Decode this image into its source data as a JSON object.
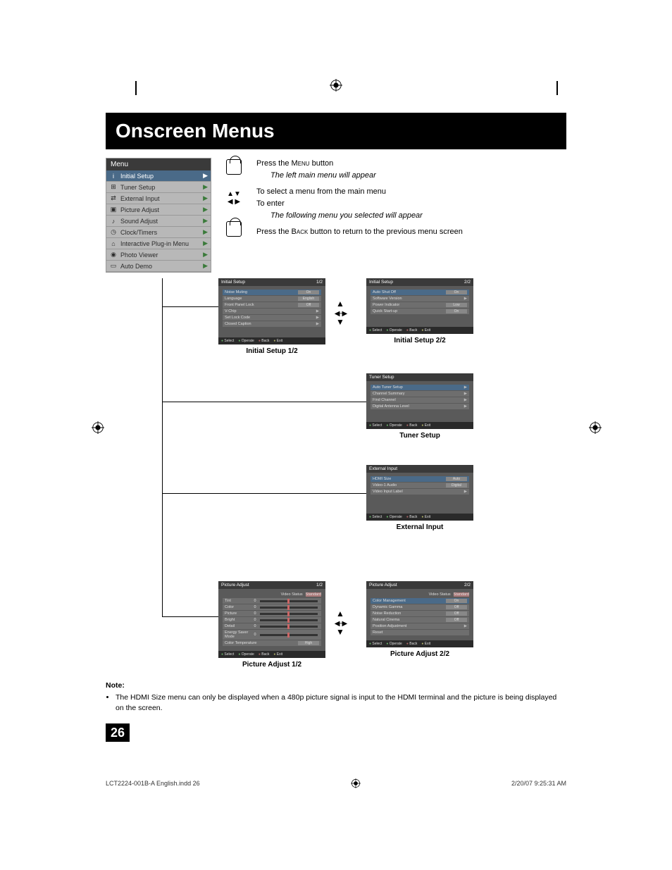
{
  "page": {
    "title": "Onscreen Menus",
    "number": "26",
    "footer_file": "LCT2224-001B-A English.indd   26",
    "footer_time": "2/20/07   9:25:31 AM"
  },
  "main_menu": {
    "header": "Menu",
    "items": [
      {
        "icon": "i",
        "label": "Initial Setup",
        "selected": true
      },
      {
        "icon": "⊞",
        "label": "Tuner Setup"
      },
      {
        "icon": "⇄",
        "label": "External Input"
      },
      {
        "icon": "▣",
        "label": "Picture Adjust"
      },
      {
        "icon": "♪",
        "label": "Sound Adjust"
      },
      {
        "icon": "◷",
        "label": "Clock/Timers"
      },
      {
        "icon": "⌂",
        "label": "Interactive Plug-in Menu"
      },
      {
        "icon": "◉",
        "label": "Photo Viewer"
      },
      {
        "icon": "▭",
        "label": "Auto Demo"
      }
    ]
  },
  "instructions": {
    "l1a": "Press the ",
    "l1b": "Menu",
    "l1c": " button",
    "l2": "The left main menu will appear",
    "l3": "To select a menu from the main menu",
    "l4": "To enter",
    "l5": "The following menu you selected will appear",
    "l6a": "Press the ",
    "l6b": "Back",
    "l6c": " button to return to the previous menu screen"
  },
  "subs": {
    "initial1": {
      "title": "Initial Setup",
      "page": "1/2",
      "caption": "Initial Setup 1/2",
      "rows": [
        {
          "l": "Noise Muting",
          "v": "On",
          "sel": true
        },
        {
          "l": "Language",
          "v": "English"
        },
        {
          "l": "Front Panel Lock",
          "v": "Off"
        },
        {
          "l": "V-Chip",
          "arr": true
        },
        {
          "l": "Set Lock Code",
          "arr": true
        },
        {
          "l": "Closed Caption",
          "arr": true
        }
      ]
    },
    "initial2": {
      "title": "Initial Setup",
      "page": "2/2",
      "caption": "Initial Setup 2/2",
      "rows": [
        {
          "l": "Auto Shut Off",
          "v": "On",
          "sel": true
        },
        {
          "l": "Software Version",
          "arr": true
        },
        {
          "l": "Power Indicator",
          "v": "Low"
        },
        {
          "l": "Quick Start-up",
          "v": "On"
        }
      ]
    },
    "tuner": {
      "title": "Tuner Setup",
      "page": "",
      "caption": "Tuner Setup",
      "rows": [
        {
          "l": "Auto Tuner Setup",
          "arr": true,
          "sel": true
        },
        {
          "l": "Channel Summary",
          "arr": true
        },
        {
          "l": "Find Channel",
          "arr": true
        },
        {
          "l": "Digital Antenna Level",
          "arr": true
        }
      ]
    },
    "ext": {
      "title": "External Input",
      "page": "",
      "caption": "External Input",
      "rows": [
        {
          "l": "HDMI Size",
          "v": "Auto",
          "sel": true
        },
        {
          "l": "Video-1 Audio",
          "v": "Digital"
        },
        {
          "l": "Video Input Label",
          "arr": true
        }
      ]
    },
    "pic1": {
      "title": "Picture Adjust",
      "page": "1/2",
      "caption": "Picture Adjust 1/2",
      "status_label": "Video Status",
      "status_value": "Standard",
      "rows": [
        {
          "l": "Tint",
          "n": "0"
        },
        {
          "l": "Color",
          "n": "0"
        },
        {
          "l": "Picture",
          "n": "0"
        },
        {
          "l": "Bright",
          "n": "0"
        },
        {
          "l": "Detail",
          "n": "0"
        },
        {
          "l": "Energy Saver Mode",
          "n": "0"
        }
      ],
      "last": {
        "l": "Color Temperature",
        "v": "High"
      }
    },
    "pic2": {
      "title": "Picture Adjust",
      "page": "2/2",
      "caption": "Picture Adjust 2/2",
      "status_label": "Video Status",
      "status_value": "Standard",
      "rows": [
        {
          "l": "Color Management",
          "v": "On",
          "sel": true
        },
        {
          "l": "Dynamic Gamma",
          "v": "Off"
        },
        {
          "l": "Noise Reduction",
          "v": "Off"
        },
        {
          "l": "Natural Cinema",
          "v": "Off"
        },
        {
          "l": "Position Adjustment",
          "arr": true
        },
        {
          "l": "Reset"
        }
      ]
    },
    "footer": {
      "a": "Select",
      "b": "Operate",
      "c": "Back",
      "d": "Exit"
    }
  },
  "note": {
    "heading": "Note:",
    "text": "The HDMI Size menu can only be displayed when a 480p picture signal is input to the HDMI terminal and the picture is being displayed on the screen."
  }
}
